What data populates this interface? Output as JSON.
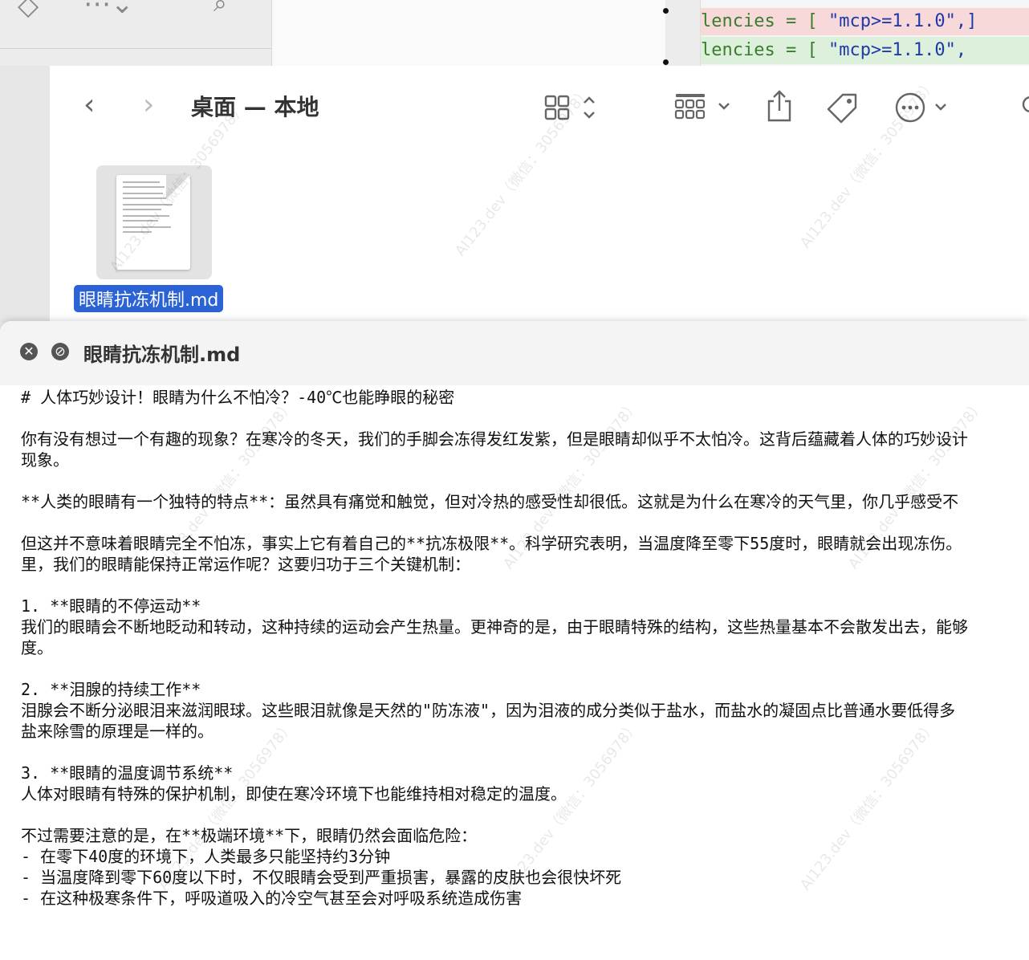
{
  "background": {
    "code_lines": [
      {
        "prefix": "lencies = [ ",
        "value": "\"mcp>=1.1.0\",]",
        "highlight": "#f7d9d9"
      },
      {
        "prefix": "lencies = [ ",
        "value": "\"mcp>=1.1.0\",",
        "highlight": "#dcf0dc"
      }
    ]
  },
  "finder": {
    "title": "桌面 — 本地",
    "back_icon": "chevron-left-icon",
    "forward_icon": "chevron-right-icon",
    "file": {
      "name": "眼睛抗冻机制.md"
    }
  },
  "quicklook": {
    "title": "眼睛抗冻机制.md",
    "lines": [
      "# 人体巧妙设计！眼睛为什么不怕冷？-40℃也能睁眼的秘密",
      "",
      "你有没有想过一个有趣的现象？在寒冷的冬天，我们的手脚会冻得发红发紫，但是眼睛却似乎不太怕冷。这背后蕴藏着人体的巧妙设计",
      "现象。",
      "",
      "**人类的眼睛有一个独特的特点**：虽然具有痛觉和触觉，但对冷热的感受性却很低。这就是为什么在寒冷的天气里，你几乎感受不",
      "",
      "但这并不意味着眼睛完全不怕冻，事实上它有着自己的**抗冻极限**。科学研究表明，当温度降至零下55度时，眼睛就会出现冻伤。",
      "里，我们的眼睛能保持正常运作呢？这要归功于三个关键机制：",
      "",
      "1. **眼睛的不停运动**",
      "我们的眼睛会不断地眨动和转动，这种持续的运动会产生热量。更神奇的是，由于眼睛特殊的结构，这些热量基本不会散发出去，能够",
      "度。",
      "",
      "2. **泪腺的持续工作**",
      "泪腺会不断分泌眼泪来滋润眼球。这些眼泪就像是天然的\"防冻液\"，因为泪液的成分类似于盐水，而盐水的凝固点比普通水要低得多",
      "盐来除雪的原理是一样的。",
      "",
      "3. **眼睛的温度调节系统**",
      "人体对眼睛有特殊的保护机制，即使在寒冷环境下也能维持相对稳定的温度。",
      "",
      "不过需要注意的是，在**极端环境**下，眼睛仍然会面临危险：",
      "- 在零下40度的环境下，人类最多只能坚持约3分钟",
      "- 当温度降到零下60度以下时，不仅眼睛会受到严重损害，暴露的皮肤也会很快坏死",
      "- 在这种极寒条件下，呼吸道吸入的冷空气甚至会对呼吸系统造成伤害"
    ]
  },
  "watermark": "AI123.dev（微信：3056978）"
}
